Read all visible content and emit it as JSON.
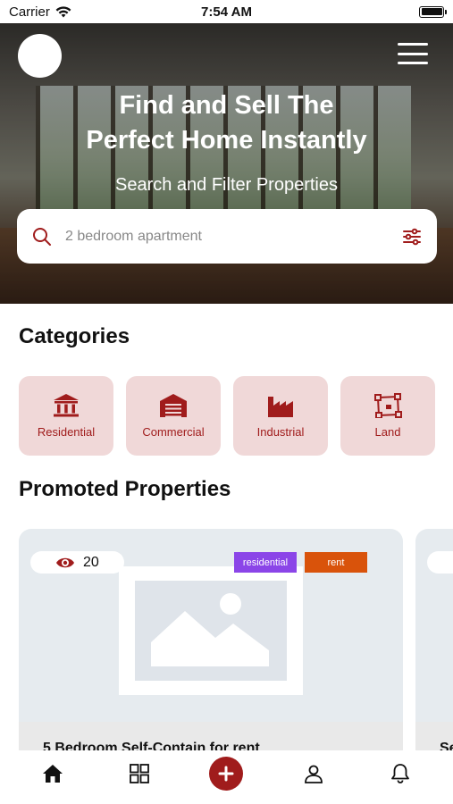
{
  "status_bar": {
    "carrier": "Carrier",
    "time": "7:54 AM"
  },
  "hero": {
    "title_line1": "Find and Sell The",
    "title_line2": "Perfect Home Instantly",
    "subtitle": "Search and Filter Properties"
  },
  "search": {
    "placeholder": "2 bedroom apartment",
    "value": ""
  },
  "categories": {
    "title": "Categories",
    "items": [
      {
        "label": "Residential",
        "icon": "bank-icon"
      },
      {
        "label": "Commercial",
        "icon": "warehouse-icon"
      },
      {
        "label": "Industrial",
        "icon": "factory-icon"
      },
      {
        "label": "Land",
        "icon": "land-plot-icon"
      }
    ]
  },
  "promoted": {
    "title": "Promoted Properties",
    "cards": [
      {
        "views": "20",
        "type_tag": "residential",
        "purpose_tag": "rent",
        "title": "5 Bedroom Self-Contain for rent"
      },
      {
        "title": "Se"
      }
    ]
  },
  "colors": {
    "accent": "#a01c1c",
    "category_bg": "#f0d8d8",
    "tag_residential": "#8b45e8",
    "tag_rent": "#d9530b"
  },
  "nav": {
    "items": [
      "home-icon",
      "grid-icon",
      "add-icon",
      "profile-icon",
      "bell-icon"
    ]
  }
}
